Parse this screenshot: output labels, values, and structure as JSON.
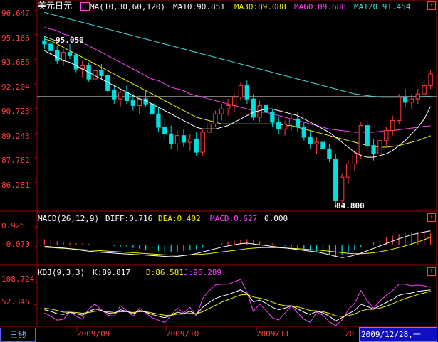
{
  "header": {
    "symbol": "美元日元",
    "ma_label": "MA(10,30,60,120)",
    "ma10": "MA10:90.851",
    "ma30": "MA30:89.088",
    "ma60": "MA60:89.688",
    "ma120": "MA120:91.454"
  },
  "price_axis": [
    "96.647",
    "95.166",
    "93.685",
    "92.204",
    "90.723",
    "89.243",
    "87.762",
    "86.281"
  ],
  "annotations": {
    "high": "95.050",
    "low": "84.800"
  },
  "macd": {
    "label": "MACD(26,12,9)",
    "diff": "DIFF:0.716",
    "dea": "DEA:0.402",
    "macd": "MACD:0.627",
    "extra": "0.000",
    "axis": [
      "0.925",
      "-0.070"
    ]
  },
  "kdj": {
    "label": "KDJ(9,3,3)",
    "k": "K:89.817",
    "d": "D:86.581",
    "j": "J:96.289",
    "axis": [
      "108.724",
      "52.346"
    ]
  },
  "footer": {
    "tab": "日线",
    "months": [
      "2009/09",
      "2009/10",
      "2009/11",
      "20"
    ],
    "date": "2009/12/28,一"
  },
  "colors": {
    "up": "#ff3c3c",
    "down": "#00e0e0",
    "ma10": "#ffffff",
    "ma30": "#f0f000",
    "ma60": "#ff40ff",
    "ma120": "#40e0e0",
    "grid": "#a00000"
  },
  "chart_data": [
    {
      "type": "candlestick",
      "title": "美元日元",
      "y_ticks": [
        96.647,
        95.166,
        93.685,
        92.204,
        90.723,
        89.243,
        87.762,
        86.281
      ],
      "ylim": [
        84.6,
        96.647
      ],
      "ohlc": [
        [
          94.8,
          95.05,
          94.3,
          94.6
        ],
        [
          94.6,
          94.9,
          94.0,
          94.2
        ],
        [
          94.2,
          94.5,
          93.4,
          93.6
        ],
        [
          93.6,
          94.3,
          93.3,
          94.1
        ],
        [
          94.1,
          94.6,
          93.7,
          93.9
        ],
        [
          93.9,
          94.0,
          92.9,
          93.1
        ],
        [
          93.1,
          93.6,
          92.6,
          93.3
        ],
        [
          93.3,
          93.5,
          92.3,
          92.5
        ],
        [
          92.5,
          93.2,
          92.1,
          93.0
        ],
        [
          93.0,
          93.4,
          92.5,
          92.7
        ],
        [
          92.7,
          92.9,
          91.6,
          91.8
        ],
        [
          91.8,
          92.1,
          91.0,
          91.3
        ],
        [
          91.3,
          91.9,
          90.8,
          91.7
        ],
        [
          91.7,
          92.1,
          91.0,
          91.2
        ],
        [
          91.2,
          91.6,
          90.6,
          90.9
        ],
        [
          90.9,
          91.5,
          90.4,
          91.3
        ],
        [
          91.3,
          91.8,
          90.8,
          91.0
        ],
        [
          91.0,
          91.2,
          90.2,
          90.4
        ],
        [
          90.4,
          90.8,
          89.3,
          89.6
        ],
        [
          89.6,
          90.1,
          88.9,
          89.2
        ],
        [
          89.2,
          89.7,
          88.3,
          88.6
        ],
        [
          88.6,
          89.4,
          88.2,
          89.1
        ],
        [
          89.1,
          89.5,
          88.4,
          88.7
        ],
        [
          88.7,
          89.2,
          88.2,
          88.9
        ],
        [
          88.9,
          89.3,
          87.9,
          88.1
        ],
        [
          88.1,
          89.5,
          87.9,
          89.3
        ],
        [
          89.3,
          90.1,
          89.0,
          89.8
        ],
        [
          89.8,
          90.6,
          89.6,
          90.4
        ],
        [
          90.4,
          91.0,
          90.0,
          90.7
        ],
        [
          90.7,
          91.3,
          90.3,
          90.9
        ],
        [
          90.9,
          91.6,
          90.5,
          91.4
        ],
        [
          91.4,
          92.3,
          91.2,
          92.1
        ],
        [
          92.1,
          92.4,
          91.0,
          91.3
        ],
        [
          91.3,
          91.6,
          90.0,
          90.2
        ],
        [
          90.2,
          91.2,
          89.9,
          90.9
        ],
        [
          90.9,
          91.4,
          90.1,
          90.5
        ],
        [
          90.5,
          90.7,
          89.6,
          89.9
        ],
        [
          89.9,
          90.2,
          89.2,
          89.5
        ],
        [
          89.5,
          90.0,
          89.1,
          89.8
        ],
        [
          89.8,
          90.4,
          89.4,
          90.1
        ],
        [
          90.1,
          90.5,
          89.3,
          89.6
        ],
        [
          89.6,
          89.9,
          88.8,
          89.0
        ],
        [
          89.0,
          89.4,
          88.3,
          88.6
        ],
        [
          88.6,
          89.0,
          88.0,
          88.7
        ],
        [
          88.7,
          89.1,
          88.1,
          88.3
        ],
        [
          88.3,
          88.6,
          87.5,
          87.7
        ],
        [
          87.7,
          88.0,
          84.8,
          85.2
        ],
        [
          85.2,
          86.8,
          85.0,
          86.6
        ],
        [
          86.6,
          87.6,
          86.2,
          87.4
        ],
        [
          87.4,
          88.2,
          87.0,
          88.0
        ],
        [
          88.0,
          89.9,
          87.7,
          89.7
        ],
        [
          89.7,
          90.0,
          88.2,
          88.5
        ],
        [
          88.5,
          88.9,
          87.6,
          88.0
        ],
        [
          88.0,
          89.0,
          87.8,
          88.8
        ],
        [
          88.8,
          89.6,
          88.5,
          89.4
        ],
        [
          89.4,
          90.3,
          89.1,
          90.0
        ],
        [
          90.0,
          91.6,
          89.8,
          91.4
        ],
        [
          91.4,
          91.9,
          90.8,
          91.1
        ],
        [
          91.1,
          91.6,
          90.7,
          91.3
        ],
        [
          91.3,
          91.9,
          91.0,
          91.6
        ],
        [
          91.6,
          92.4,
          91.3,
          92.1
        ],
        [
          92.1,
          93.0,
          91.9,
          92.8
        ]
      ],
      "ma10": [
        94.2,
        94.0,
        93.8,
        93.6,
        93.5,
        93.3,
        93.1,
        92.9,
        92.7,
        92.5,
        92.3,
        92.1,
        91.9,
        91.7,
        91.5,
        91.3,
        91.2,
        91.0,
        90.8,
        90.6,
        90.4,
        90.2,
        90.0,
        89.8,
        89.6,
        89.5,
        89.5,
        89.5,
        89.6,
        89.7,
        89.9,
        90.1,
        90.3,
        90.5,
        90.6,
        90.7,
        90.7,
        90.6,
        90.5,
        90.4,
        90.3,
        90.1,
        89.9,
        89.7,
        89.5,
        89.3,
        89.0,
        88.7,
        88.4,
        88.1,
        87.9,
        87.8,
        87.8,
        87.9,
        88.0,
        88.2,
        88.5,
        88.8,
        89.2,
        89.6,
        90.1,
        90.85
      ],
      "ma30": [
        94.9,
        94.8,
        94.6,
        94.4,
        94.2,
        94.0,
        93.8,
        93.6,
        93.4,
        93.2,
        93.0,
        92.8,
        92.6,
        92.4,
        92.2,
        92.0,
        91.8,
        91.6,
        91.4,
        91.2,
        91.0,
        90.8,
        90.6,
        90.4,
        90.2,
        90.1,
        90.0,
        89.9,
        89.8,
        89.8,
        89.8,
        89.8,
        89.8,
        89.8,
        89.8,
        89.8,
        89.8,
        89.8,
        89.7,
        89.7,
        89.6,
        89.5,
        89.4,
        89.3,
        89.2,
        89.1,
        89.0,
        88.9,
        88.8,
        88.7,
        88.6,
        88.5,
        88.45,
        88.4,
        88.4,
        88.45,
        88.5,
        88.6,
        88.7,
        88.8,
        88.95,
        89.09
      ],
      "ma60": [
        95.6,
        95.5,
        95.4,
        95.2,
        95.1,
        94.9,
        94.7,
        94.5,
        94.3,
        94.1,
        93.9,
        93.7,
        93.5,
        93.3,
        93.1,
        92.9,
        92.7,
        92.5,
        92.4,
        92.2,
        92.0,
        91.9,
        91.8,
        91.6,
        91.5,
        91.4,
        91.3,
        91.2,
        91.1,
        91.0,
        90.9,
        90.8,
        90.7,
        90.6,
        90.5,
        90.5,
        90.4,
        90.3,
        90.2,
        90.1,
        90.0,
        89.9,
        89.8,
        89.7,
        89.6,
        89.5,
        89.45,
        89.4,
        89.35,
        89.3,
        89.3,
        89.3,
        89.3,
        89.35,
        89.4,
        89.4,
        89.45,
        89.5,
        89.55,
        89.6,
        89.65,
        89.69
      ],
      "ma120": [
        96.5,
        96.4,
        96.3,
        96.2,
        96.1,
        96.0,
        95.9,
        95.8,
        95.7,
        95.6,
        95.5,
        95.4,
        95.3,
        95.2,
        95.1,
        95.0,
        94.9,
        94.8,
        94.7,
        94.6,
        94.5,
        94.4,
        94.3,
        94.2,
        94.1,
        94.0,
        93.9,
        93.8,
        93.7,
        93.6,
        93.5,
        93.4,
        93.3,
        93.2,
        93.1,
        93.0,
        92.9,
        92.8,
        92.7,
        92.6,
        92.5,
        92.4,
        92.3,
        92.2,
        92.1,
        92.0,
        91.9,
        91.8,
        91.7,
        91.6,
        91.55,
        91.5,
        91.45,
        91.4,
        91.4,
        91.4,
        91.4,
        91.4,
        91.42,
        91.43,
        91.44,
        91.454
      ]
    },
    {
      "type": "bar",
      "title": "MACD(26,12,9)",
      "ylim": [
        -0.9,
        1.1
      ],
      "y_ticks": [
        0.925,
        -0.07
      ],
      "macd": [
        0.3,
        0.25,
        0.2,
        0.18,
        0.12,
        0.1,
        0.08,
        0.06,
        0.04,
        0.02,
        0.0,
        -0.04,
        -0.08,
        -0.1,
        -0.14,
        -0.18,
        -0.22,
        -0.26,
        -0.3,
        -0.34,
        -0.36,
        -0.34,
        -0.3,
        -0.26,
        -0.2,
        -0.12,
        -0.04,
        0.04,
        0.1,
        0.16,
        0.22,
        0.28,
        0.3,
        0.26,
        0.2,
        0.14,
        0.08,
        0.02,
        -0.04,
        -0.1,
        -0.16,
        -0.2,
        -0.26,
        -0.32,
        -0.4,
        -0.48,
        -0.56,
        -0.5,
        -0.4,
        -0.26,
        -0.1,
        0.06,
        0.16,
        0.28,
        0.38,
        0.48,
        0.56,
        0.62,
        0.66,
        0.68,
        0.66,
        0.627
      ],
      "diff": [
        -0.05,
        -0.08,
        -0.12,
        -0.14,
        -0.18,
        -0.22,
        -0.26,
        -0.3,
        -0.33,
        -0.36,
        -0.38,
        -0.4,
        -0.42,
        -0.44,
        -0.46,
        -0.48,
        -0.5,
        -0.52,
        -0.54,
        -0.56,
        -0.58,
        -0.56,
        -0.52,
        -0.48,
        -0.42,
        -0.34,
        -0.26,
        -0.18,
        -0.1,
        -0.04,
        0.02,
        0.08,
        0.1,
        0.06,
        0.02,
        -0.02,
        -0.06,
        -0.1,
        -0.14,
        -0.18,
        -0.22,
        -0.26,
        -0.3,
        -0.34,
        -0.4,
        -0.48,
        -0.56,
        -0.62,
        -0.58,
        -0.5,
        -0.4,
        -0.28,
        -0.16,
        -0.04,
        0.08,
        0.2,
        0.32,
        0.42,
        0.52,
        0.6,
        0.66,
        0.716
      ],
      "dea": [
        -0.1,
        -0.12,
        -0.14,
        -0.16,
        -0.18,
        -0.2,
        -0.22,
        -0.24,
        -0.26,
        -0.28,
        -0.3,
        -0.32,
        -0.34,
        -0.36,
        -0.38,
        -0.4,
        -0.42,
        -0.44,
        -0.46,
        -0.48,
        -0.5,
        -0.5,
        -0.5,
        -0.49,
        -0.47,
        -0.45,
        -0.42,
        -0.38,
        -0.34,
        -0.3,
        -0.26,
        -0.22,
        -0.18,
        -0.15,
        -0.13,
        -0.12,
        -0.12,
        -0.13,
        -0.14,
        -0.16,
        -0.18,
        -0.2,
        -0.22,
        -0.24,
        -0.27,
        -0.3,
        -0.34,
        -0.38,
        -0.41,
        -0.43,
        -0.43,
        -0.41,
        -0.38,
        -0.33,
        -0.27,
        -0.2,
        -0.12,
        -0.04,
        0.06,
        0.16,
        0.28,
        0.402
      ]
    },
    {
      "type": "line",
      "title": "KDJ(9,3,3)",
      "ylim": [
        0,
        125
      ],
      "y_ticks": [
        108.724,
        52.346
      ],
      "k": [
        40,
        36,
        30,
        28,
        34,
        30,
        26,
        36,
        42,
        38,
        32,
        30,
        40,
        36,
        30,
        38,
        34,
        28,
        24,
        20,
        26,
        34,
        30,
        36,
        28,
        46,
        58,
        68,
        74,
        78,
        84,
        90,
        80,
        60,
        64,
        56,
        46,
        40,
        44,
        50,
        42,
        34,
        28,
        36,
        32,
        24,
        12,
        20,
        30,
        38,
        54,
        48,
        42,
        50,
        58,
        66,
        76,
        80,
        82,
        86,
        88,
        89.817
      ],
      "d": [
        44,
        42,
        38,
        34,
        34,
        33,
        31,
        33,
        36,
        37,
        35,
        33,
        35,
        35,
        33,
        35,
        35,
        32,
        29,
        26,
        26,
        29,
        29,
        31,
        30,
        35,
        43,
        51,
        59,
        65,
        71,
        77,
        78,
        72,
        69,
        65,
        59,
        53,
        50,
        50,
        47,
        43,
        38,
        37,
        35,
        31,
        25,
        23,
        25,
        29,
        37,
        41,
        41,
        44,
        49,
        55,
        62,
        68,
        73,
        78,
        82,
        86.581
      ],
      "j": [
        32,
        24,
        14,
        16,
        34,
        24,
        16,
        42,
        54,
        40,
        26,
        24,
        50,
        38,
        24,
        44,
        32,
        20,
        14,
        8,
        26,
        44,
        32,
        46,
        24,
        68,
        88,
        102,
        104,
        104,
        110,
        116,
        84,
        36,
        54,
        38,
        20,
        14,
        32,
        50,
        32,
        16,
        8,
        34,
        26,
        10,
        -14,
        14,
        40,
        56,
        88,
        62,
        44,
        62,
        76,
        88,
        104,
        104,
        100,
        102,
        100,
        96.289
      ]
    }
  ]
}
